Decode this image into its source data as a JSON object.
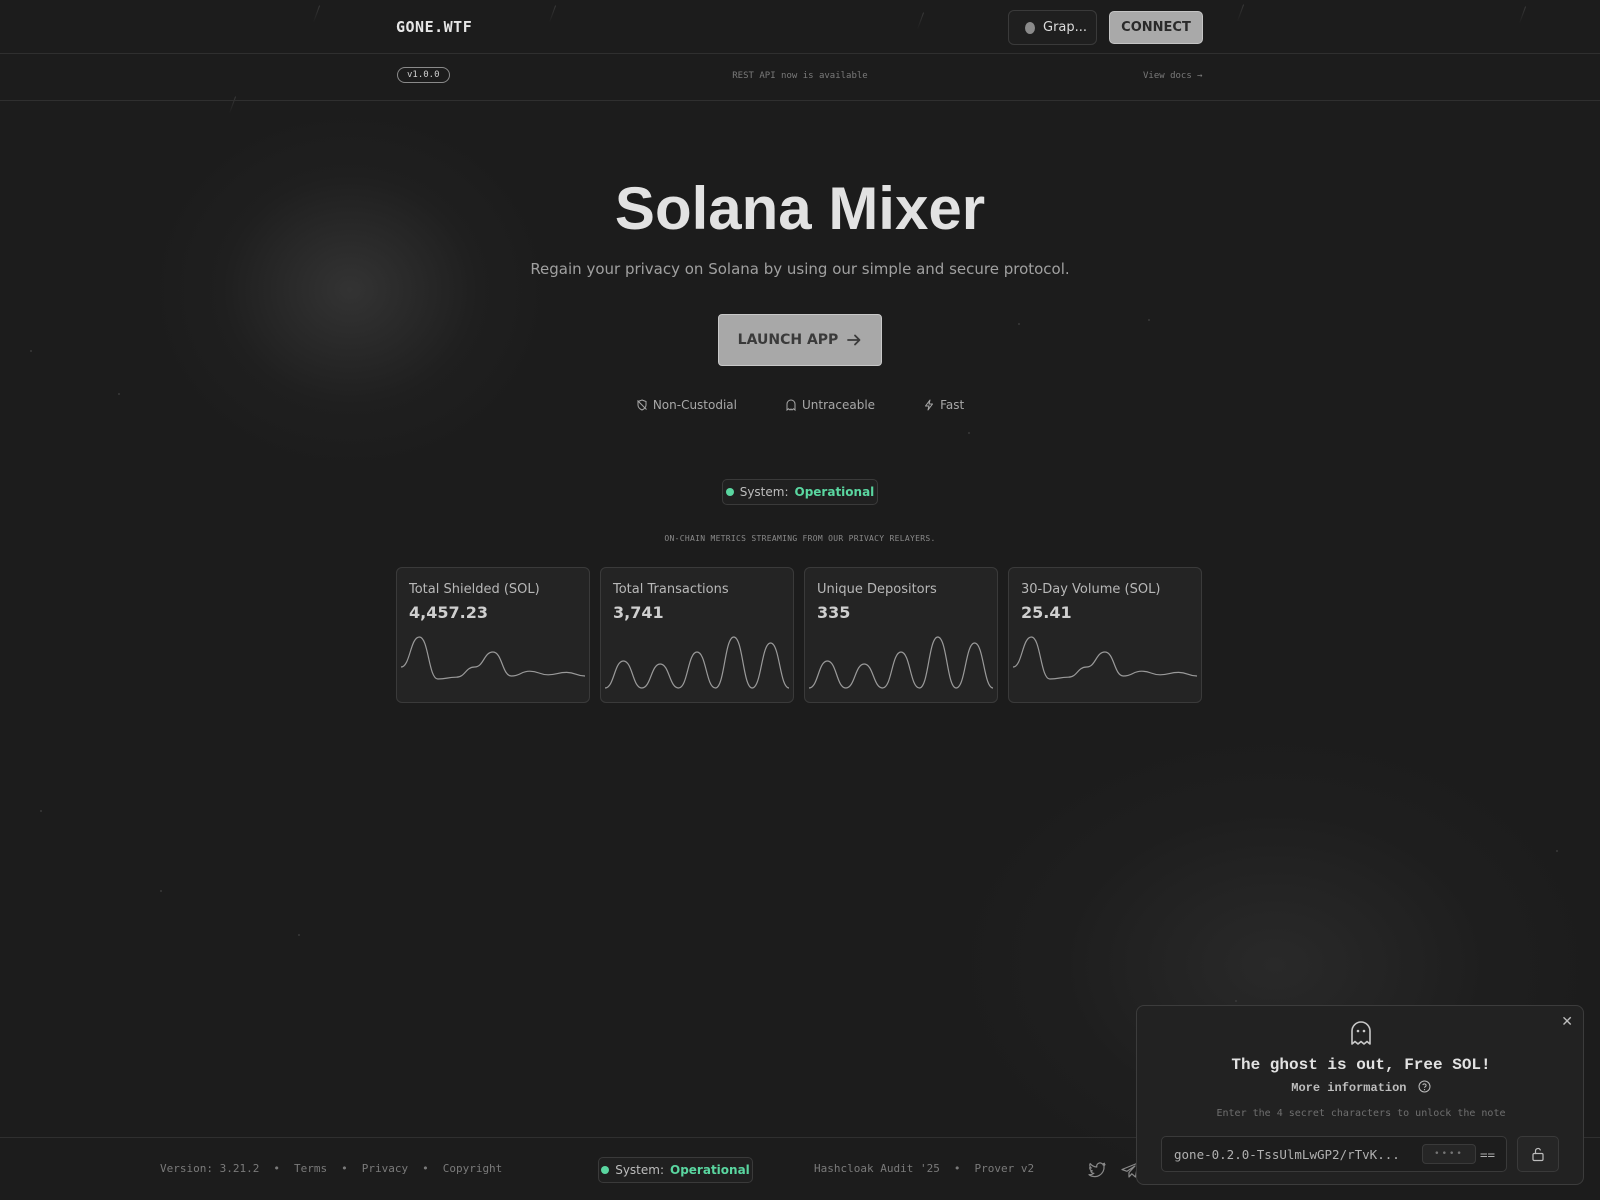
{
  "header": {
    "logo": "GONE.WTF",
    "graph_button": "Grap...",
    "connect_button": "CONNECT"
  },
  "subbar": {
    "version": "v1.0.0",
    "announcement": "REST API now is available",
    "docs_link": "View docs →"
  },
  "hero": {
    "title": "Solana Mixer",
    "subtitle": "Regain your privacy on Solana by using our simple and secure protocol.",
    "launch_button": "LAUNCH APP",
    "features": [
      "Non-Custodial",
      "Untraceable",
      "Fast"
    ]
  },
  "status": {
    "label": "System:",
    "value": "Operational",
    "color": "#5ad6a0"
  },
  "metrics": {
    "note": "ON-CHAIN METRICS STREAMING FROM OUR PRIVACY RELAYERS.",
    "cards": [
      {
        "title": "Total Shielded (SOL)",
        "value": "4,457.23",
        "spark": [
          0.55,
          0.05,
          0.75,
          0.72,
          0.55,
          0.3,
          0.7,
          0.62,
          0.68,
          0.64,
          0.7
        ]
      },
      {
        "title": "Total Transactions",
        "value": "3,741",
        "spark": [
          0.9,
          0.45,
          0.9,
          0.5,
          0.9,
          0.3,
          0.9,
          0.05,
          0.9,
          0.15,
          0.9
        ]
      },
      {
        "title": "Unique Depositors",
        "value": "335",
        "spark": [
          0.9,
          0.45,
          0.9,
          0.5,
          0.9,
          0.3,
          0.9,
          0.05,
          0.9,
          0.15,
          0.9
        ]
      },
      {
        "title": "30-Day Volume (SOL)",
        "value": "25.41",
        "spark": [
          0.55,
          0.05,
          0.75,
          0.72,
          0.55,
          0.3,
          0.7,
          0.62,
          0.68,
          0.64,
          0.7
        ]
      }
    ]
  },
  "footer": {
    "version": "Version: 3.21.2",
    "links": [
      "Terms",
      "Privacy",
      "Copyright"
    ],
    "audit": "Hashcloak Audit '25",
    "prover": "Prover v2",
    "separator": "•"
  },
  "popup": {
    "title": "The ghost is out, Free SOL!",
    "more_info": "More information",
    "hint": "Enter the 4 secret characters to unlock the note",
    "note": "gone-0.2.0-TssUlmLwGP2/rTvK...",
    "secret_placeholder": "••••",
    "note_suffix": "=="
  }
}
